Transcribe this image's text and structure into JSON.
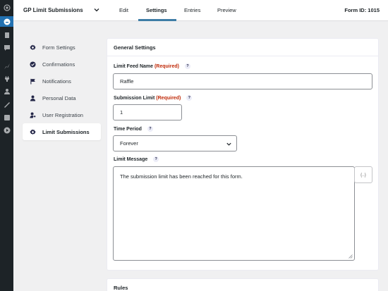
{
  "wp_sidebar": {
    "icons": [
      "gravity-forms-icon",
      "pages-icon",
      "comments-icon",
      "appearance-icon",
      "plugins-icon",
      "users-icon",
      "tools-icon",
      "settings-icon",
      "media-play-icon"
    ]
  },
  "topbar": {
    "form_title": "GP Limit Submissions",
    "tabs": [
      "Edit",
      "Settings",
      "Entries",
      "Preview"
    ],
    "active_tab": "Settings",
    "form_id": "Form ID: 1015"
  },
  "nav": {
    "items": [
      {
        "label": "Form Settings",
        "icon": "gear-icon"
      },
      {
        "label": "Confirmations",
        "icon": "check-circle-icon"
      },
      {
        "label": "Notifications",
        "icon": "flag-icon"
      },
      {
        "label": "Personal Data",
        "icon": "person-icon"
      },
      {
        "label": "User Registration",
        "icon": "user-key-icon"
      },
      {
        "label": "Limit Submissions",
        "icon": "gear-icon"
      }
    ],
    "active": "Limit Submissions"
  },
  "general": {
    "heading": "General Settings",
    "feed_name_label": "Limit Feed Name",
    "required_text": "(Required)",
    "feed_name_value": "Raffle",
    "submission_limit_label": "Submission Limit",
    "submission_limit_value": "1",
    "time_period_label": "Time Period",
    "time_period_value": "Forever",
    "limit_message_label": "Limit Message",
    "limit_message_value": "The submission limit has been reached for this form.",
    "merge_tag_button": "{..}",
    "help_glyph": "?"
  },
  "rules": {
    "heading": "Rules"
  },
  "colors": {
    "accent": "#3e7da6",
    "wp_bar": "#1d2327",
    "required": "#c02b0a"
  }
}
